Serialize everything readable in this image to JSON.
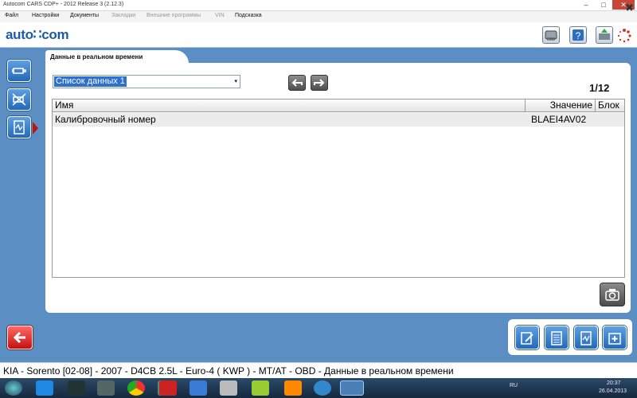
{
  "window": {
    "title": "Autocom CARS CDP+ - 2012 Release 3 (2.12.3)"
  },
  "window_controls": {
    "minimize": "–",
    "restore": "□",
    "close": "✕"
  },
  "menu": [
    {
      "label": "Файл",
      "enabled": true
    },
    {
      "label": "Настройки",
      "enabled": true
    },
    {
      "label": "Документы",
      "enabled": true
    },
    {
      "label": "Закладки",
      "enabled": false
    },
    {
      "label": "Внешние программы",
      "enabled": false
    },
    {
      "label": "VIN",
      "enabled": false
    },
    {
      "label": "Подсказка",
      "enabled": true
    }
  ],
  "header": {
    "logo": "auto∷com",
    "icons": [
      "obd-icon",
      "help-icon",
      "vehicle-icon",
      "loading-icon"
    ],
    "obd_label": "OBD"
  },
  "sidebar": {
    "items": [
      {
        "icon": "engine-icon"
      },
      {
        "icon": "engine-disabled-icon"
      },
      {
        "icon": "realtime-data-icon",
        "active": true
      }
    ],
    "back_icon": "back-arrow-icon"
  },
  "tab": {
    "label": "Данные в реальном времени"
  },
  "data_list": {
    "selected": "Список данных 1",
    "arrow": "▾"
  },
  "nav": {
    "prev_icon": "undo-arrow-icon",
    "next_icon": "redo-arrow-icon"
  },
  "pager": {
    "text": "1/12"
  },
  "table": {
    "columns": [
      "Имя",
      "Значение",
      "Блок"
    ],
    "rows": [
      {
        "name": "Калибровочный номер",
        "value": "BLAEI4AV02",
        "block": ""
      }
    ]
  },
  "camera_icon": "camera-icon",
  "bottom_toolbar": {
    "icons": [
      "edit-document-icon",
      "list-icon",
      "graph-icon",
      "medical-kit-icon"
    ]
  },
  "status_bar": {
    "text": "KIA - Sorento [02-08] - 2007 - D4CB 2.5L - Euro-4 ( KWP ) - MT/AT - OBD - Данные в реальном времени",
    "close": "✖"
  },
  "taskbar": {
    "apps": [
      "start-icon",
      "ie-icon",
      "media-icon",
      "settings-icon",
      "chrome-icon",
      "photo-icon",
      "yandex-icon",
      "mail-icon",
      "files-icon",
      "audio-icon",
      "office-icon",
      "nature-icon",
      "odnoklassniki-icon",
      "update-icon",
      "autocom-icon"
    ],
    "lang": "RU",
    "time": "20:37",
    "date": "26.04.2013"
  },
  "colors": {
    "accent": "#5b8fc4",
    "button_blue": "#2468b8",
    "back_red": "#c31010",
    "selection": "#2f6fce"
  }
}
